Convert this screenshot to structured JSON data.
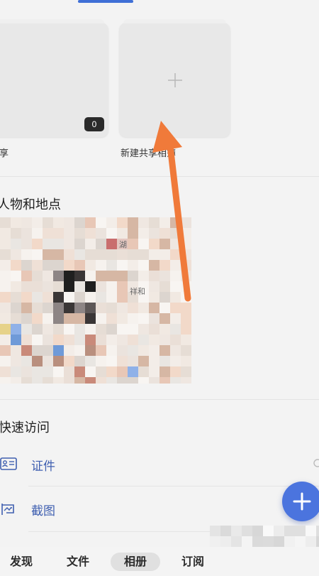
{
  "albums": {
    "shared_album_label": "共享",
    "shared_album_count": "0",
    "new_shared_album_label": "新建共享相簿"
  },
  "people_places": {
    "title": "人物和地点",
    "map_labels": [
      "湖",
      "祥和"
    ]
  },
  "quick_access": {
    "title": "快速访问",
    "items": [
      {
        "label": "证件",
        "icon": "id-card-icon"
      },
      {
        "label": "截图",
        "icon": "screenshot-icon"
      }
    ]
  },
  "fab": {
    "icon": "plus-icon"
  },
  "bottom_nav": {
    "items": [
      "发现",
      "文件",
      "相册",
      "订阅"
    ],
    "active": "相册"
  },
  "annotation": {
    "color": "#f07a3a"
  },
  "colors": {
    "accent": "#4b74de",
    "link_text": "#3f5fb0",
    "background": "#f3f3f3"
  }
}
